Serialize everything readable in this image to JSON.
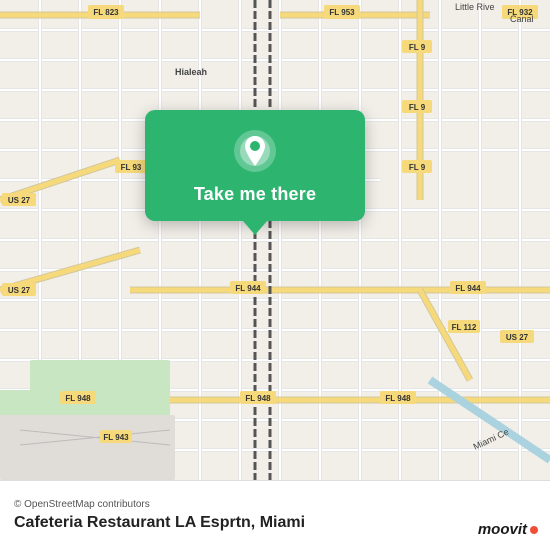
{
  "map": {
    "attribution": "© OpenStreetMap contributors",
    "background_color": "#f2efe9"
  },
  "location_card": {
    "button_label": "Take me there",
    "pin_icon": "location-pin"
  },
  "bottom_bar": {
    "place_name": "Cafeteria Restaurant LA Esprtn, Miami"
  },
  "branding": {
    "logo_text": "moovit"
  },
  "road_labels": [
    {
      "id": "fl823",
      "text": "FL 823"
    },
    {
      "id": "fl953",
      "text": "FL 953"
    },
    {
      "id": "fl932",
      "text": "FL 932"
    },
    {
      "id": "hialeah",
      "text": "Hialeah"
    },
    {
      "id": "fl9a",
      "text": "FL 9"
    },
    {
      "id": "fl9b",
      "text": "FL 9"
    },
    {
      "id": "fl9c",
      "text": "FL 9"
    },
    {
      "id": "us27a",
      "text": "US 27"
    },
    {
      "id": "fl93x",
      "text": "FL 93"
    },
    {
      "id": "us27b",
      "text": "US 27"
    },
    {
      "id": "fl944a",
      "text": "FL 944"
    },
    {
      "id": "fl944b",
      "text": "FL 944"
    },
    {
      "id": "fl112",
      "text": "FL 112"
    },
    {
      "id": "us27c",
      "text": "US 27"
    },
    {
      "id": "fl948a",
      "text": "FL 948"
    },
    {
      "id": "fl948b",
      "text": "FL 948"
    },
    {
      "id": "fl943",
      "text": "FL 943"
    },
    {
      "id": "fl948c",
      "text": "FL 948"
    },
    {
      "id": "miamice",
      "text": "Miami Ce"
    }
  ]
}
